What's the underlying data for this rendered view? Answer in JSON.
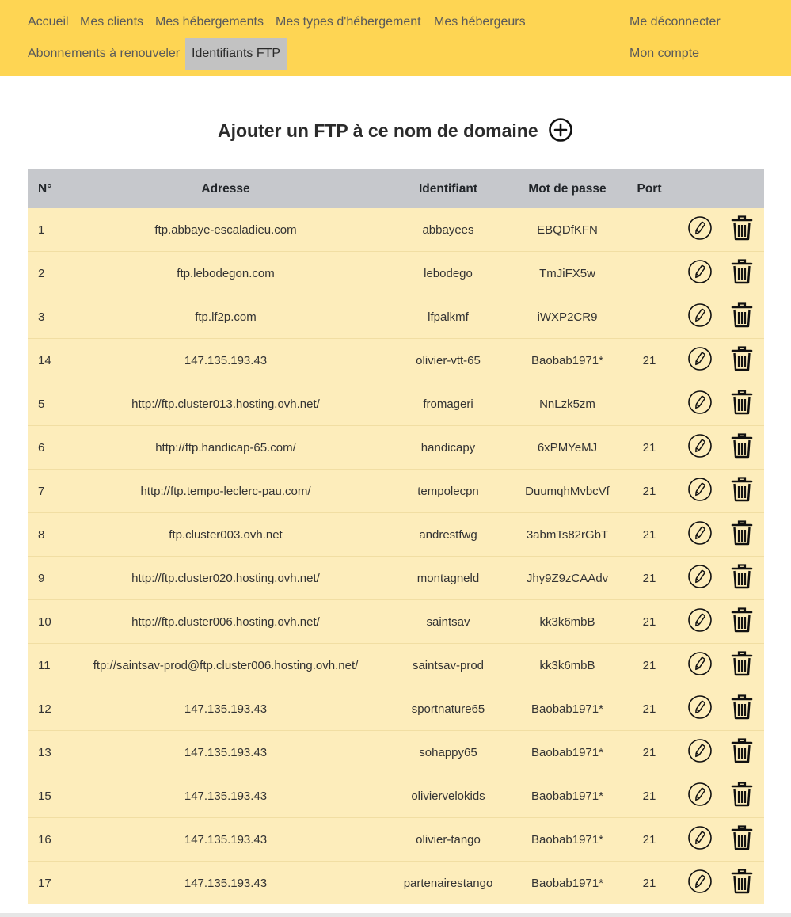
{
  "nav": {
    "accueil": "Accueil",
    "mes_clients": "Mes clients",
    "mes_hebergements": "Mes hébergements",
    "mes_types": "Mes types d'hébergement",
    "mes_hebergeurs": "Mes hébergeurs",
    "abonnements": "Abonnements à renouveler",
    "identifiants_ftp": "Identifiants FTP",
    "deconnecter": "Me déconnecter",
    "mon_compte": "Mon compte"
  },
  "colors": {
    "nav_bg": "#fed553",
    "active_tab_bg": "#c2c2c2",
    "table_header_bg": "#c6c8cc",
    "row_bg": "#fdedbb"
  },
  "page": {
    "title": "Ajouter un FTP à ce nom de domaine",
    "add_icon": "plus-circle-icon"
  },
  "table": {
    "headers": [
      "N°",
      "Adresse",
      "Identifiant",
      "Mot de passe",
      "Port"
    ],
    "rows": [
      {
        "num": "1",
        "adresse": "ftp.abbaye-escaladieu.com",
        "identifiant": "abbayees",
        "mot_de_passe": "EBQDfKFN",
        "port": ""
      },
      {
        "num": "2",
        "adresse": "ftp.lebodegon.com",
        "identifiant": "lebodego",
        "mot_de_passe": "TmJiFX5w",
        "port": ""
      },
      {
        "num": "3",
        "adresse": "ftp.lf2p.com",
        "identifiant": "lfpalkmf",
        "mot_de_passe": "iWXP2CR9",
        "port": ""
      },
      {
        "num": "14",
        "adresse": "147.135.193.43",
        "identifiant": "olivier-vtt-65",
        "mot_de_passe": "Baobab1971*",
        "port": "21"
      },
      {
        "num": "5",
        "adresse": "http://ftp.cluster013.hosting.ovh.net/",
        "identifiant": "fromageri",
        "mot_de_passe": "NnLzk5zm",
        "port": ""
      },
      {
        "num": "6",
        "adresse": "http://ftp.handicap-65.com/",
        "identifiant": "handicapy",
        "mot_de_passe": "6xPMYeMJ",
        "port": "21"
      },
      {
        "num": "7",
        "adresse": "http://ftp.tempo-leclerc-pau.com/",
        "identifiant": "tempolecpn",
        "mot_de_passe": "DuumqhMvbcVf",
        "port": "21"
      },
      {
        "num": "8",
        "adresse": "ftp.cluster003.ovh.net",
        "identifiant": "andrestfwg",
        "mot_de_passe": "3abmTs82rGbT",
        "port": "21"
      },
      {
        "num": "9",
        "adresse": "http://ftp.cluster020.hosting.ovh.net/",
        "identifiant": "montagneld",
        "mot_de_passe": "Jhy9Z9zCAAdv",
        "port": "21"
      },
      {
        "num": "10",
        "adresse": "http://ftp.cluster006.hosting.ovh.net/",
        "identifiant": "saintsav",
        "mot_de_passe": "kk3k6mbB",
        "port": "21"
      },
      {
        "num": "11",
        "adresse": "ftp://saintsav-prod@ftp.cluster006.hosting.ovh.net/",
        "identifiant": "saintsav-prod",
        "mot_de_passe": "kk3k6mbB",
        "port": "21"
      },
      {
        "num": "12",
        "adresse": "147.135.193.43",
        "identifiant": "sportnature65",
        "mot_de_passe": "Baobab1971*",
        "port": "21"
      },
      {
        "num": "13",
        "adresse": "147.135.193.43",
        "identifiant": "sohappy65",
        "mot_de_passe": "Baobab1971*",
        "port": "21"
      },
      {
        "num": "15",
        "adresse": "147.135.193.43",
        "identifiant": "oliviervelokids",
        "mot_de_passe": "Baobab1971*",
        "port": "21"
      },
      {
        "num": "16",
        "adresse": "147.135.193.43",
        "identifiant": "olivier-tango",
        "mot_de_passe": "Baobab1971*",
        "port": "21"
      },
      {
        "num": "17",
        "adresse": "147.135.193.43",
        "identifiant": "partenairestango",
        "mot_de_passe": "Baobab1971*",
        "port": "21"
      }
    ],
    "row_actions": {
      "edit_icon": "pencil-icon",
      "delete_icon": "trash-icon"
    }
  }
}
